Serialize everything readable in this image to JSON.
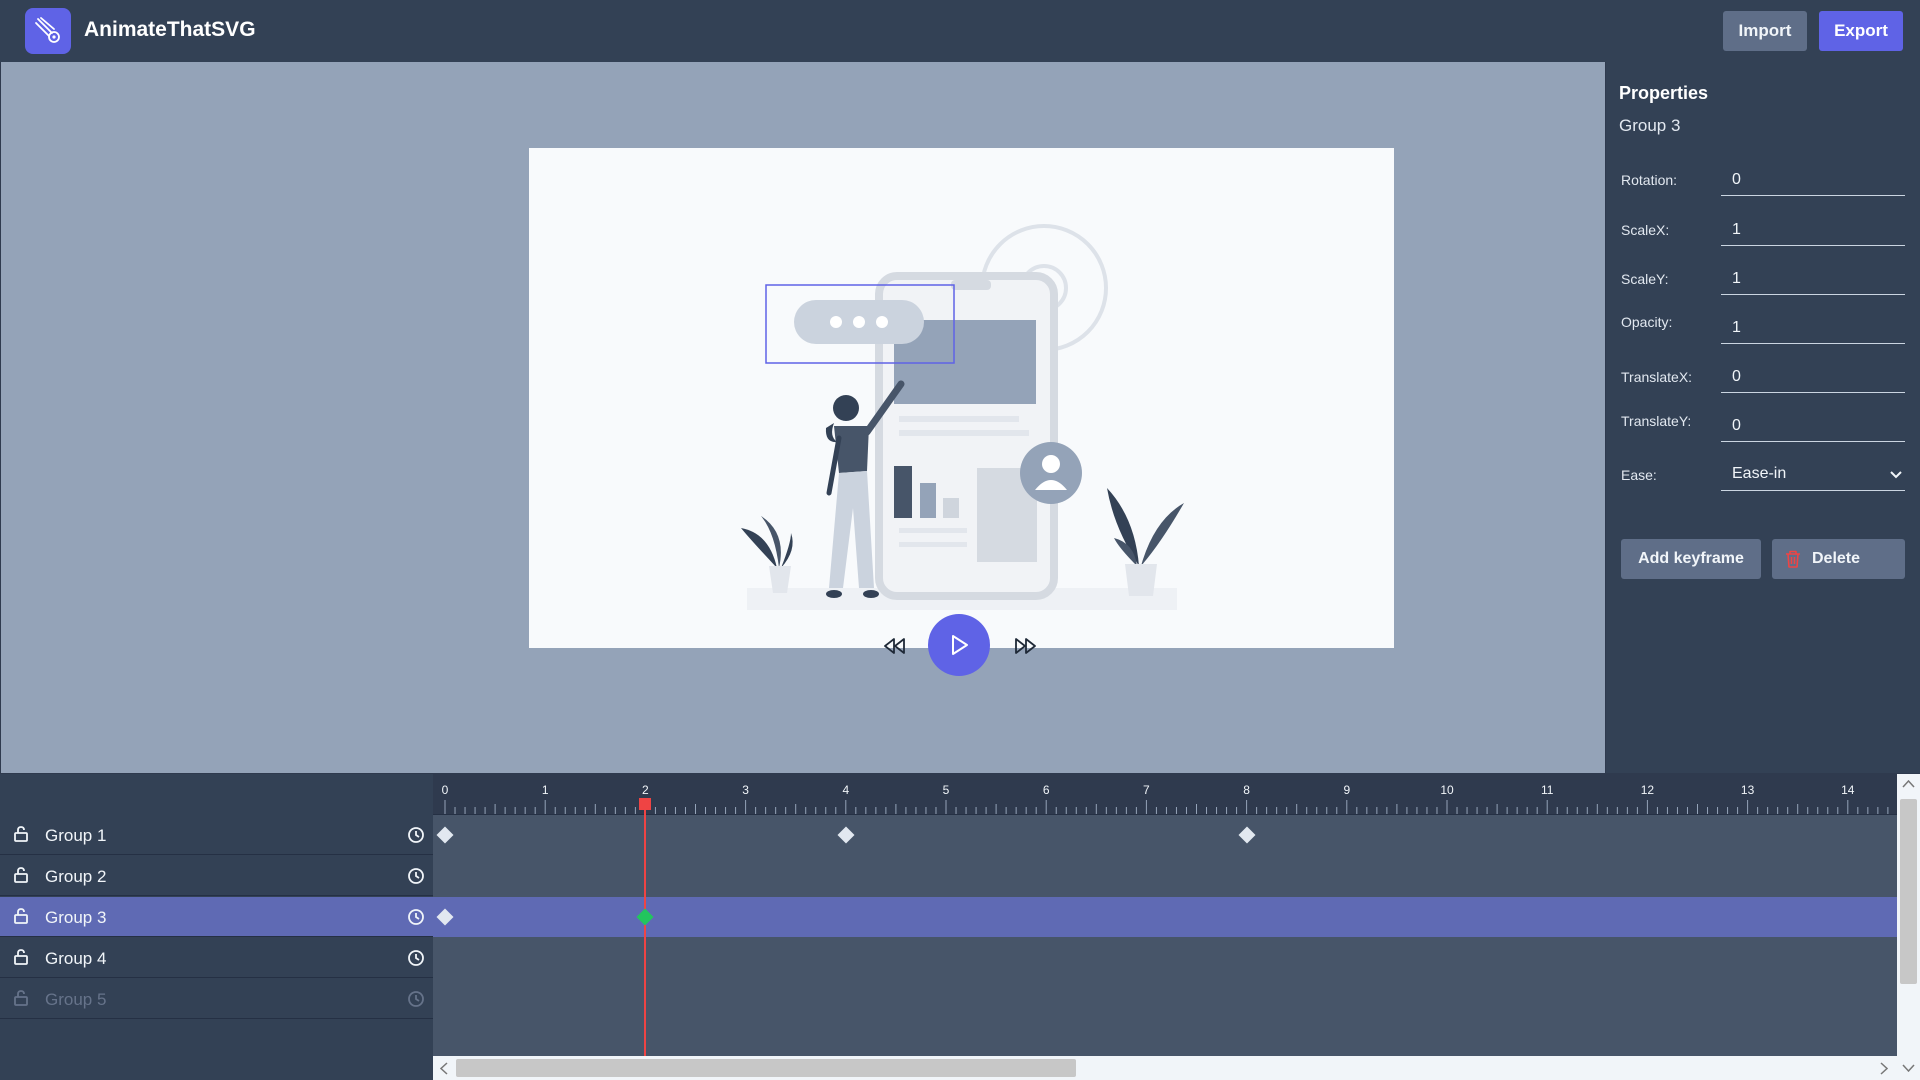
{
  "app": {
    "title": "AnimateThatSVG",
    "logo_icon": "magic-wand-icon"
  },
  "header": {
    "import_label": "Import",
    "export_label": "Export"
  },
  "colors": {
    "accent": "#5f63e6",
    "playhead": "#ef4444",
    "keyframe_active": "#22c55e",
    "selected_row": "#5f6ab4"
  },
  "properties": {
    "title": "Properties",
    "selected": "Group 3",
    "fields": [
      {
        "label": "Rotation:",
        "value": "0"
      },
      {
        "label": "ScaleX:",
        "value": "1"
      },
      {
        "label": "ScaleY:",
        "value": "1"
      },
      {
        "label": "Opacity:",
        "value": "1"
      },
      {
        "label": "TranslateX:",
        "value": "0"
      },
      {
        "label": "TranslateY:",
        "value": "0"
      }
    ],
    "ease": {
      "label": "Ease:",
      "value": "Ease-in"
    },
    "add_keyframe_label": "Add keyframe",
    "delete_label": "Delete"
  },
  "timeline": {
    "ticks": [
      "0",
      "1",
      "2",
      "3",
      "4",
      "5",
      "6",
      "7",
      "8",
      "9",
      "10",
      "11",
      "12",
      "13",
      "14"
    ],
    "current_time": 2,
    "layers": [
      {
        "name": "Group 1",
        "keyframes": [
          0,
          4,
          8
        ],
        "selected": false,
        "disabled": false
      },
      {
        "name": "Group 2",
        "keyframes": [],
        "selected": false,
        "disabled": false
      },
      {
        "name": "Group 3",
        "keyframes": [
          0,
          2
        ],
        "selected": true,
        "disabled": false
      },
      {
        "name": "Group 4",
        "keyframes": [],
        "selected": false,
        "disabled": false
      },
      {
        "name": "Group 5",
        "keyframes": [],
        "selected": false,
        "disabled": true
      }
    ]
  }
}
